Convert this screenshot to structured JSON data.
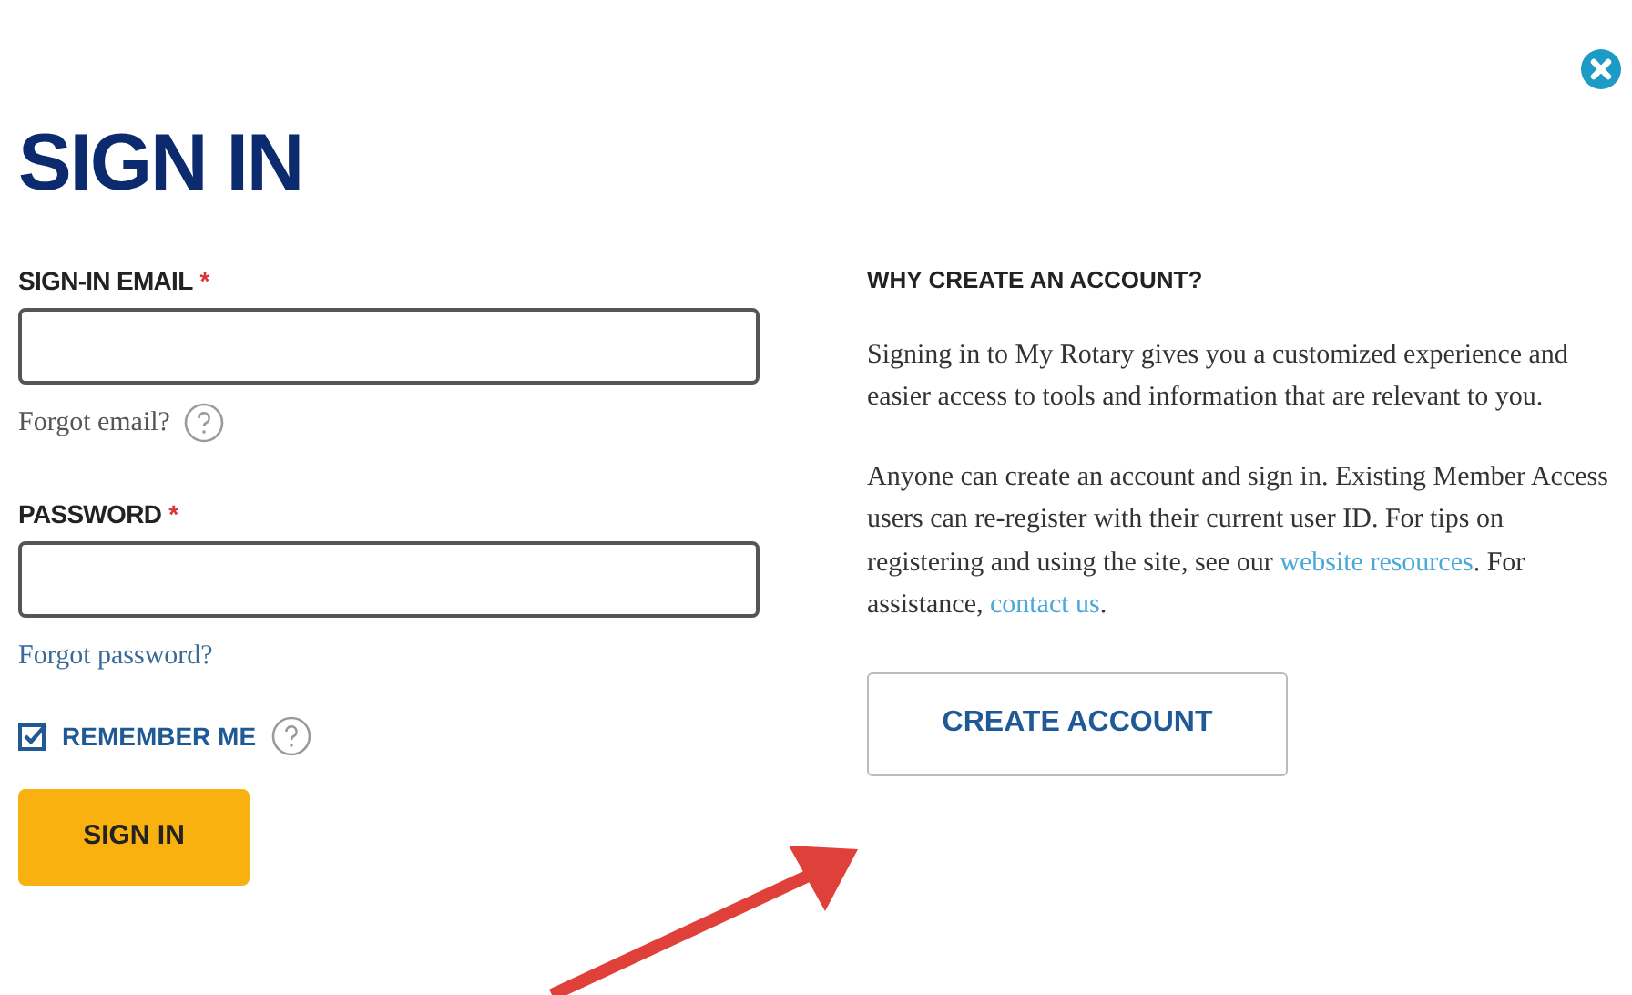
{
  "title": "SIGN IN",
  "email_field": {
    "label": "SIGN-IN EMAIL",
    "required_mark": "*",
    "link": "Forgot email?"
  },
  "password_field": {
    "label": "PASSWORD",
    "required_mark": "*",
    "link": "Forgot password?"
  },
  "remember_me": {
    "label": "REMEMBER ME",
    "checked": true
  },
  "sign_in_button": "SIGN IN",
  "info": {
    "heading": "WHY CREATE AN ACCOUNT?",
    "paragraphs": [
      [
        {
          "kind": "text",
          "text": "Signing in to My Rotary gives you a customized experience and easier access to tools and information that are relevant to you."
        }
      ],
      [
        {
          "kind": "text",
          "text": "Anyone can create an account and sign in. Existing Member Access users can re-register with their current user ID. For tips on registering and using the site, see our "
        },
        {
          "kind": "link",
          "text": "website resources"
        },
        {
          "kind": "text",
          "text": ". For assistance, "
        },
        {
          "kind": "link",
          "text": "contact us"
        },
        {
          "kind": "text",
          "text": "."
        }
      ]
    ]
  },
  "create_account_button": "CREATE ACCOUNT"
}
